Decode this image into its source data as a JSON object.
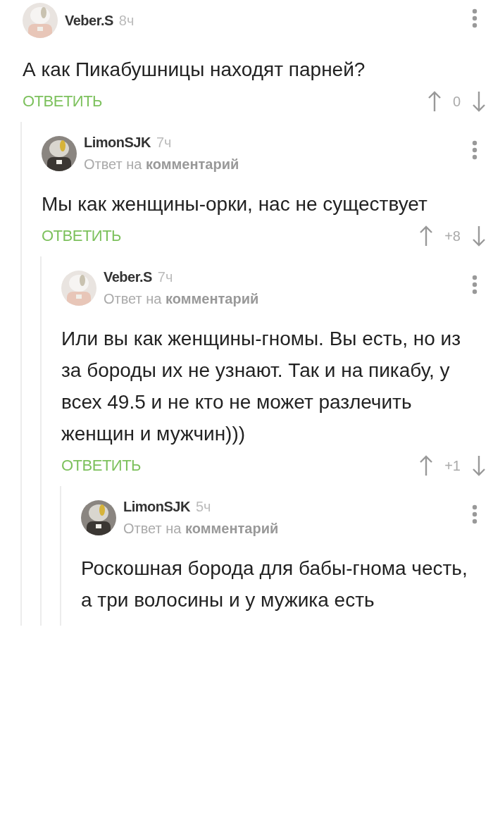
{
  "comments": [
    {
      "author": "Veber.S",
      "time": "8ч",
      "text": "А как Пикабушницы находят парней?",
      "reply_button": "ОТВЕТИТЬ",
      "score": "0",
      "children": [
        {
          "author": "LimonSJK",
          "time": "7ч",
          "reply_to": "Ответ на **комментарий**",
          "text": "Мы как женщины-орки, нас не существует",
          "reply_button": "ОТВЕТИТЬ",
          "score": "+8",
          "children": [
            {
              "author": "Veber.S",
              "time": "7ч",
              "reply_to": "Ответ на **комментарий**",
              "text": "Или вы как женщины-гномы. Вы есть, но из за бороды их не узнают. Так и на пикабу, у всех 49.5 и не кто не может разлечить женщин и мужчин)))",
              "reply_button": "ОТВЕТИТЬ",
              "score": "+1",
              "children": [
                {
                  "author": "LimonSJK",
                  "time": "5ч",
                  "reply_to": "Ответ на **комментарий**",
                  "text": "Роскошная борода для бабы-гнома честь, а три волосины и у мужика есть"
                }
              ]
            }
          ]
        }
      ]
    }
  ]
}
